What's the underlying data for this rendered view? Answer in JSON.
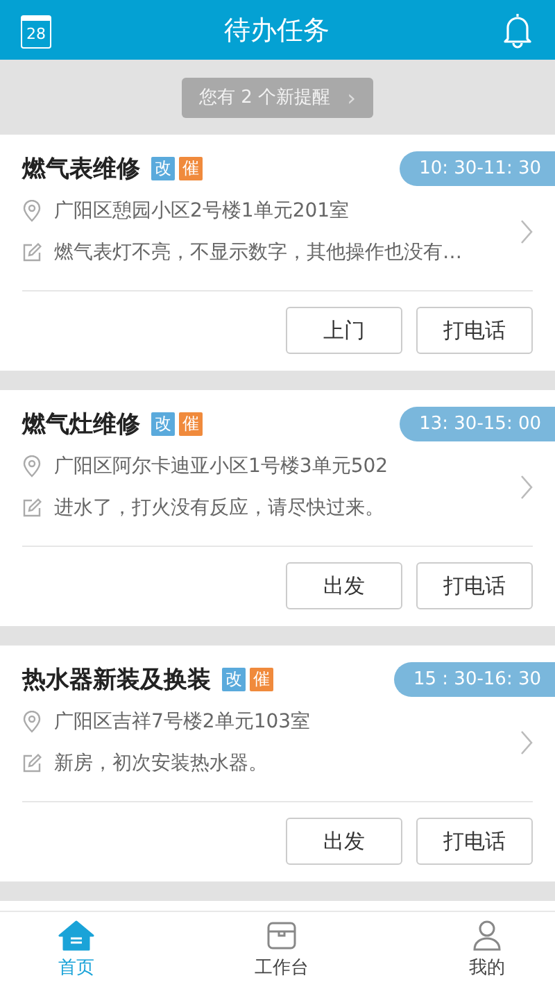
{
  "header": {
    "title": "待办任务",
    "calendar_day": "28"
  },
  "reminder": {
    "text": "您有 2 个新提醒",
    "arrow": "›"
  },
  "tasks": [
    {
      "title": "燃气表维修",
      "tags": [
        {
          "label": "改",
          "color": "#5aaadc"
        },
        {
          "label": "催",
          "color": "#f08a3c"
        }
      ],
      "time": "10: 30-11: 30",
      "address": "广阳区憩园小区2号楼1单元201室",
      "note": "燃气表灯不亮，不显示数字，其他操作也没有…",
      "buttons": [
        "上门",
        "打电话"
      ]
    },
    {
      "title": "燃气灶维修",
      "tags": [
        {
          "label": "改",
          "color": "#5aaadc"
        },
        {
          "label": "催",
          "color": "#f08a3c"
        }
      ],
      "time": "13: 30-15: 00",
      "address": "广阳区阿尔卡迪亚小区1号楼3单元502",
      "note": "进水了，打火没有反应，请尽快过来。",
      "buttons": [
        "出发",
        "打电话"
      ]
    },
    {
      "title": "热水器新装及换装",
      "tags": [
        {
          "label": "改",
          "color": "#5aaadc"
        },
        {
          "label": "催",
          "color": "#f08a3c"
        }
      ],
      "time": "15 : 30-16: 30",
      "address": "广阳区吉祥7号楼2单元103室",
      "note": "新房，初次安装热水器。",
      "buttons": [
        "出发",
        "打电话"
      ]
    }
  ],
  "tabbar": [
    {
      "label": "首页",
      "kind": "home",
      "selected": true
    },
    {
      "label": "工作台",
      "kind": "toolbox",
      "selected": false
    },
    {
      "label": "我的",
      "kind": "person",
      "selected": false
    }
  ]
}
